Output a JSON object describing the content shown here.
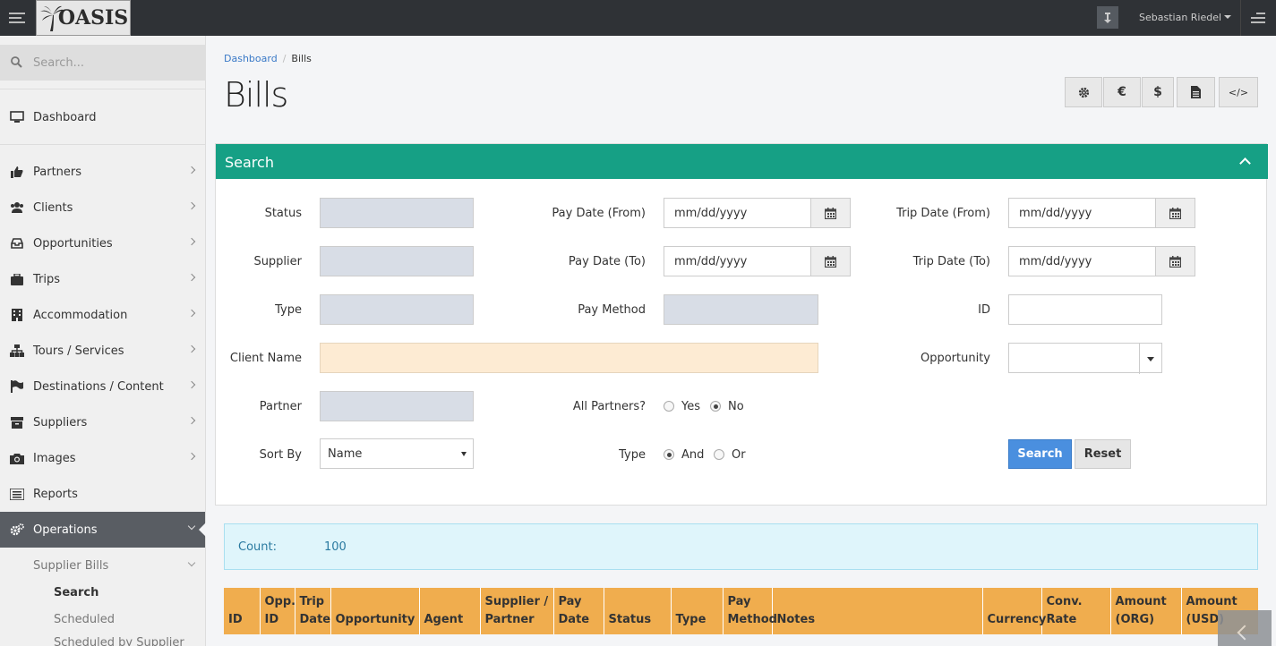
{
  "app": {
    "logo_text": "OASIS",
    "user_name": "Sebastian Riedel"
  },
  "sidebar": {
    "search_placeholder": "Search...",
    "items": [
      {
        "label": "Dashboard",
        "icon": "monitor-icon"
      },
      {
        "label": "Partners",
        "icon": "thumbs-up-icon"
      },
      {
        "label": "Clients",
        "icon": "users-icon"
      },
      {
        "label": "Opportunities",
        "icon": "inbox-icon"
      },
      {
        "label": "Trips",
        "icon": "suitcase-icon"
      },
      {
        "label": "Accommodation",
        "icon": "building-icon"
      },
      {
        "label": "Tours / Services",
        "icon": "sitemap-icon"
      },
      {
        "label": "Destinations / Content",
        "icon": "flag-icon"
      },
      {
        "label": "Suppliers",
        "icon": "archive-icon"
      },
      {
        "label": "Images",
        "icon": "camera-icon"
      },
      {
        "label": "Reports",
        "icon": "list-icon"
      },
      {
        "label": "Operations",
        "icon": "cogs-icon"
      }
    ],
    "sub_items": [
      {
        "label": "Supplier Bills"
      },
      {
        "label": "Search"
      },
      {
        "label": "Scheduled"
      },
      {
        "label": "Scheduled by Supplier"
      }
    ]
  },
  "breadcrumb": {
    "home": "Dashboard",
    "current": "Bills"
  },
  "page": {
    "title": "Bills"
  },
  "toolbar": {
    "euro": "€",
    "dollar": "$",
    "code": "</>"
  },
  "search_panel": {
    "title": "Search",
    "labels": {
      "status": "Status",
      "supplier": "Supplier",
      "type": "Type",
      "client_name": "Client Name",
      "partner": "Partner",
      "sort_by": "Sort By",
      "pay_date_from": "Pay Date (From)",
      "pay_date_to": "Pay Date (To)",
      "pay_method": "Pay Method",
      "all_partners": "All Partners?",
      "type2": "Type",
      "trip_date_from": "Trip Date (From)",
      "trip_date_to": "Trip Date (To)",
      "id": "ID",
      "opportunity": "Opportunity"
    },
    "date_placeholder": "mm/dd/yyyy",
    "sort_by_value": "Name",
    "radio": {
      "yes": "Yes",
      "no": "No",
      "and": "And",
      "or": "Or"
    },
    "buttons": {
      "search": "Search",
      "reset": "Reset"
    }
  },
  "count": {
    "label": "Count:",
    "value": "100"
  },
  "table": {
    "headers": [
      "ID",
      "Opp. ID",
      "Trip Date",
      "Opportunity",
      "Agent",
      "Supplier / Partner",
      "Pay Date",
      "Status",
      "Type",
      "Pay Method",
      "Notes",
      "Currency",
      "Conv. Rate",
      "Amount (ORG)",
      "Amount (USD)"
    ]
  }
}
